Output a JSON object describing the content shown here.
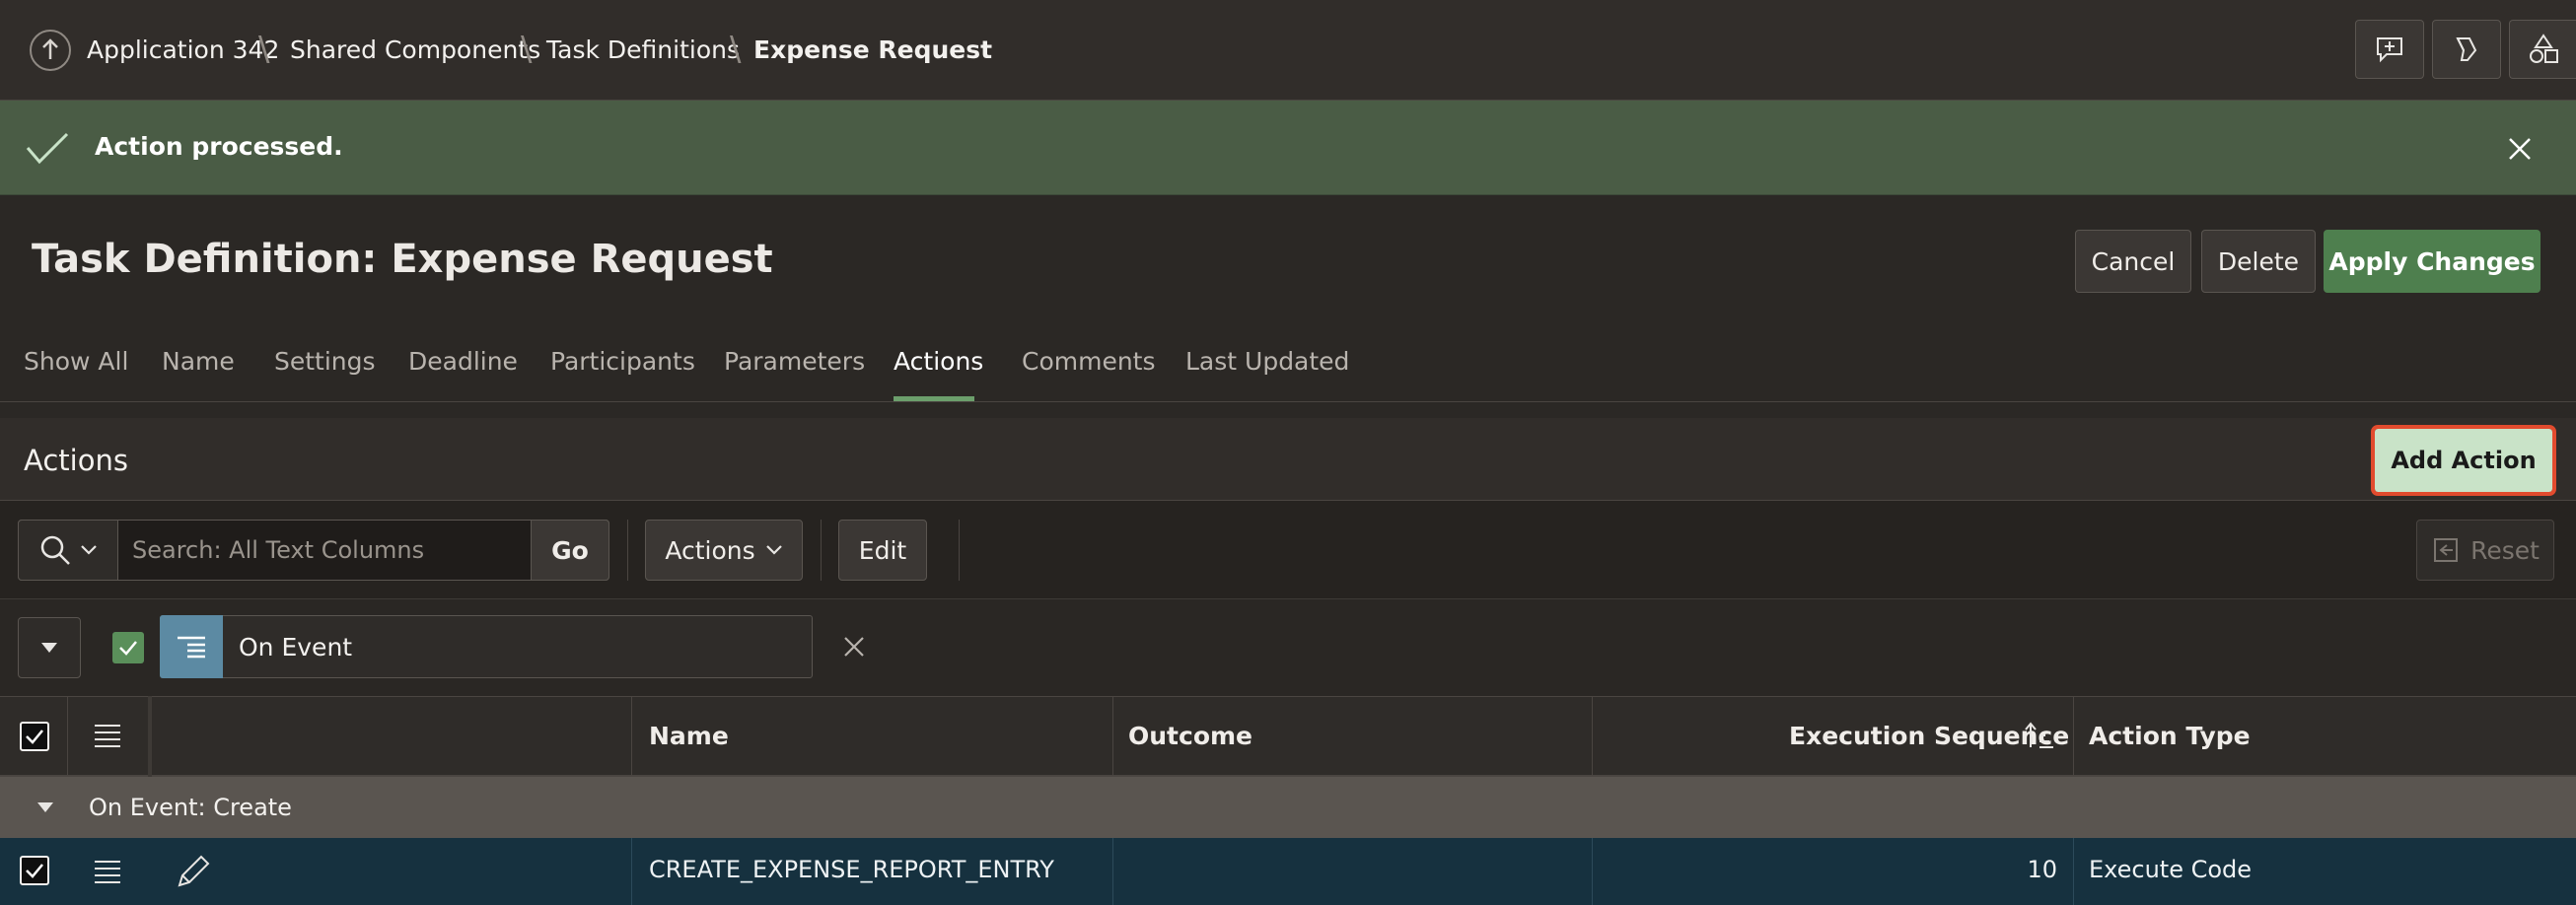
{
  "breadcrumb": {
    "items": [
      {
        "label": "Application 342"
      },
      {
        "label": "Shared Components"
      },
      {
        "label": "Task Definitions"
      },
      {
        "label": "Expense Request"
      }
    ]
  },
  "banner": {
    "message": "Action processed.",
    "color": "#4a5c45"
  },
  "header": {
    "title": "Task Definition: Expense Request",
    "buttons": {
      "cancel": "Cancel",
      "delete": "Delete",
      "apply": "Apply Changes"
    }
  },
  "tabs": [
    {
      "label": "Show All"
    },
    {
      "label": "Name"
    },
    {
      "label": "Settings"
    },
    {
      "label": "Deadline"
    },
    {
      "label": "Participants"
    },
    {
      "label": "Parameters"
    },
    {
      "label": "Actions",
      "active": true
    },
    {
      "label": "Comments"
    },
    {
      "label": "Last Updated"
    }
  ],
  "region": {
    "title": "Actions",
    "add_button": "Add Action"
  },
  "toolbar": {
    "search_placeholder": "Search: All Text Columns",
    "go": "Go",
    "actions": "Actions",
    "edit": "Edit",
    "reset": "Reset"
  },
  "filter": {
    "label": "On Event",
    "checked": true
  },
  "grid": {
    "columns": [
      "Name",
      "Outcome",
      "Execution Sequence",
      "Action Type"
    ],
    "sorted_column": "Execution Sequence",
    "group_label": "On Event: Create",
    "rows": [
      {
        "name": "CREATE_EXPENSE_REPORT_ENTRY",
        "outcome": "",
        "sequence": "10",
        "action_type": "Execute Code",
        "selected": true
      }
    ]
  },
  "colors": {
    "accent_green": "#4e7f4e",
    "selected_row": "#16313f",
    "highlight_outline": "#e24b2e"
  },
  "icons": {
    "up": "arrow-up-circle-icon",
    "feedback": "chat-plus-icon",
    "debug": "marker-icon",
    "shared": "shapes-icon",
    "success": "check-icon",
    "close": "close-icon"
  }
}
